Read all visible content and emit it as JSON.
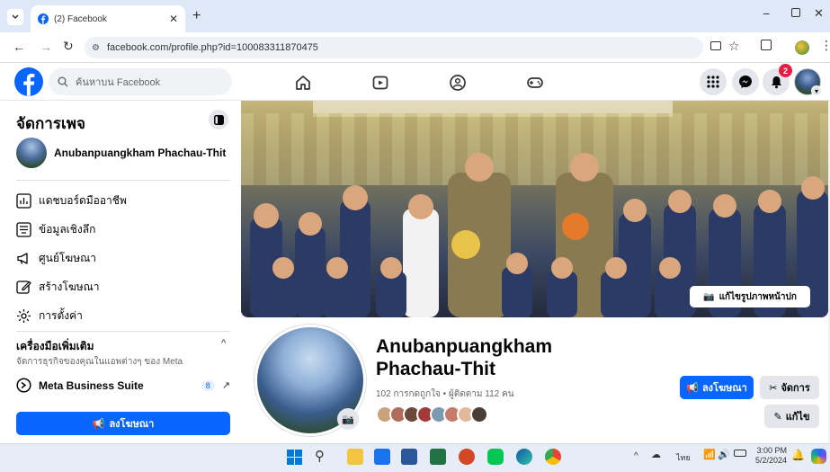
{
  "browser": {
    "tab_title": "(2) Facebook",
    "url": "facebook.com/profile.php?id=100083311870475"
  },
  "fb": {
    "search_placeholder": "ค้นหาบน Facebook",
    "notification_count": "2"
  },
  "sidebar": {
    "title": "จัดการเพจ",
    "page_name": "Anubanpuangkham Phachau-Thit",
    "items": [
      {
        "label": "แดชบอร์ดมืออาชีพ",
        "icon": "dashboard-icon"
      },
      {
        "label": "ข้อมูลเชิงลึก",
        "icon": "insights-icon"
      },
      {
        "label": "ศูนย์โฆษณา",
        "icon": "megaphone-icon"
      },
      {
        "label": "สร้างโฆษณา",
        "icon": "edit-icon"
      },
      {
        "label": "การตั้งค่า",
        "icon": "gear-icon"
      }
    ],
    "more_tools_title": "เครื่องมือเพิ่มเติม",
    "more_tools_sub": "จัดการธุรกิจของคุณในแอพต่างๆ ของ Meta",
    "meta_suite_label": "Meta Business Suite",
    "meta_suite_badge": "8",
    "advertise_button": "ลงโฆษณา"
  },
  "cover": {
    "edit_button": "แก้ไขรูปภาพหน้าปก"
  },
  "profile": {
    "name_line1": "Anubanpuangkham",
    "name_line2": "Phachau-Thit",
    "stats": "102 การกดถูกใจ • ผู้ติดตาม 112 คน",
    "advertise_button": "ลงโฆษณา",
    "manage_button": "จัดการ",
    "edit_button": "แก้ไข"
  },
  "taskbar": {
    "time": "3:00 PM",
    "date": "5/2/2024",
    "lang": "ไทย"
  },
  "colors": {
    "fb_blue": "#0866ff",
    "accent": "#1877f2"
  }
}
